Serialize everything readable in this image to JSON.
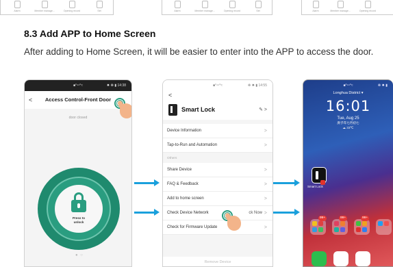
{
  "section": {
    "heading": "8.3 Add APP to Home Screen",
    "paragraph": "After adding to Home Screen, it will be easier to enter into the APP to access the door."
  },
  "top_strip": {
    "tabs": [
      "Alarm",
      "Member manage...",
      "Opening record",
      "Set"
    ]
  },
  "phone_door": {
    "status": "■°⁴⁴°≈",
    "status_right": "✸ ☸ ▮ 14:38",
    "back": "<",
    "title": "Access Control-Front Door",
    "door_state": "door closed",
    "press_line1": "Press to",
    "press_line2": "unlock",
    "pager": "● ○"
  },
  "phone_settings": {
    "status": "■°⁴⁴°≈",
    "status_right": "☸ ✸ ▮ 14:55",
    "back": "<",
    "device_name": "Smart Lock",
    "edit": "✎ >",
    "rows_top": [
      {
        "label": "Device Information"
      },
      {
        "label": "Tap-to-Run and Automation"
      }
    ],
    "others_label": "Others",
    "rows_bottom": [
      {
        "label": "Share Device",
        "extra": ""
      },
      {
        "label": "FAQ & Feedback",
        "extra": ""
      },
      {
        "label": "Add to home screen",
        "extra": ""
      },
      {
        "label": "Check Device Network",
        "extra": "ck Now"
      },
      {
        "label": "Check for Firmware Update",
        "extra": ""
      }
    ],
    "chevron": ">",
    "remove": "Remove Device"
  },
  "phone_home": {
    "status": "■°⁴⁴°≈",
    "status_right": "☸ ✸ ▮",
    "district": "Longhua District ▾",
    "time": "16:01",
    "date": "Tue, Aug 25",
    "lunar": "庚子年七月初七",
    "weather": "☁ 33℃",
    "app_label": "Smart Lock",
    "badge": "99+"
  },
  "colors": {
    "accent_green": "#2a9d80",
    "arrow_blue": "#1aa0dc"
  }
}
